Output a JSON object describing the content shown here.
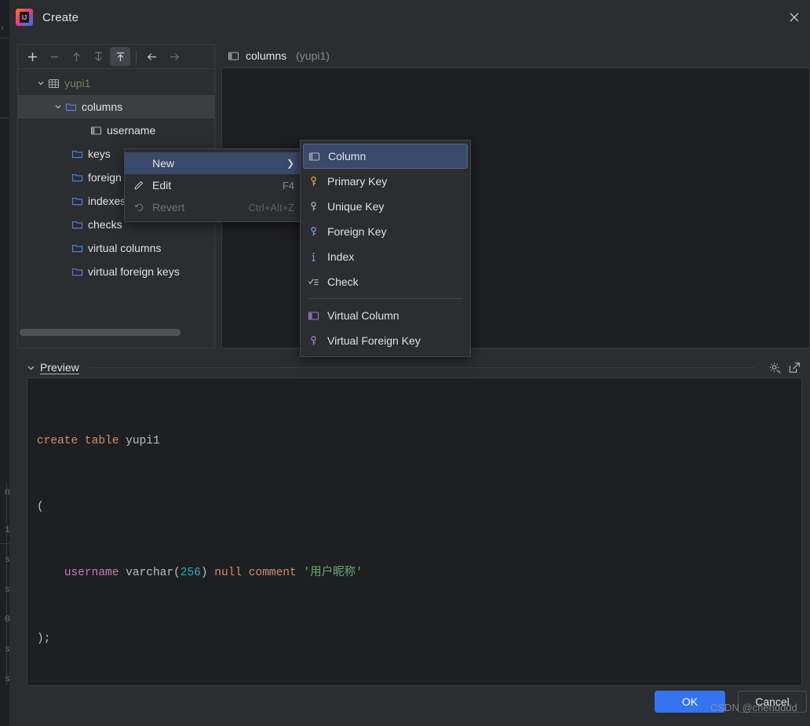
{
  "window": {
    "title": "Create",
    "logo_icon": "intellij-idea-logo",
    "close_icon": "close-icon"
  },
  "toolbar": {
    "buttons": [
      {
        "name": "add-button",
        "icon": "plus-icon",
        "enabled": true,
        "active": false
      },
      {
        "name": "remove-button",
        "icon": "minus-icon",
        "enabled": false,
        "active": false
      },
      {
        "name": "move-up-button",
        "icon": "arrow-up-icon",
        "enabled": false,
        "active": false
      },
      {
        "name": "move-down-button",
        "icon": "arrow-down-icon",
        "enabled": false,
        "active": false
      },
      {
        "name": "move-to-top-button",
        "icon": "arrow-to-top-icon",
        "enabled": true,
        "active": true
      },
      {
        "name": "back-button",
        "icon": "arrow-left-icon",
        "enabled": true,
        "active": false
      },
      {
        "name": "forward-button",
        "icon": "arrow-right-icon",
        "enabled": false,
        "active": false
      }
    ]
  },
  "tree": {
    "nodes": [
      {
        "label": "yupi1",
        "icon": "table-icon",
        "indent": 0,
        "expanded": true,
        "selected": false,
        "color": "green"
      },
      {
        "label": "columns",
        "icon": "folder-icon",
        "indent": 1,
        "expanded": true,
        "selected": true,
        "color": "default"
      },
      {
        "label": "username",
        "icon": "column-icon",
        "indent": 2,
        "expanded": null,
        "selected": false,
        "color": "default"
      },
      {
        "label": "keys",
        "icon": "folder-icon",
        "indent": 1,
        "expanded": null,
        "selected": false,
        "color": "default"
      },
      {
        "label": "foreign keys",
        "icon": "folder-icon",
        "indent": 1,
        "expanded": null,
        "selected": false,
        "color": "default"
      },
      {
        "label": "indexes",
        "icon": "folder-icon",
        "indent": 1,
        "expanded": null,
        "selected": false,
        "color": "default"
      },
      {
        "label": "checks",
        "icon": "folder-icon",
        "indent": 1,
        "expanded": null,
        "selected": false,
        "color": "default"
      },
      {
        "label": "virtual columns",
        "icon": "folder-icon",
        "indent": 1,
        "expanded": null,
        "selected": false,
        "color": "default"
      },
      {
        "label": "virtual foreign keys",
        "icon": "folder-icon",
        "indent": 1,
        "expanded": null,
        "selected": false,
        "color": "default"
      }
    ]
  },
  "detail": {
    "icon": "column-icon",
    "name": "columns",
    "owner": "(yupi1)"
  },
  "context_menu": {
    "items": [
      {
        "label": "New",
        "icon": "none",
        "accel": "",
        "highlighted": true,
        "disabled": false,
        "submenu": true
      },
      {
        "label": "Edit",
        "icon": "pencil-icon",
        "accel": "F4",
        "highlighted": false,
        "disabled": false,
        "submenu": false
      },
      {
        "label": "Revert",
        "icon": "revert-icon",
        "accel": "Ctrl+Alt+Z",
        "highlighted": false,
        "disabled": true,
        "submenu": false
      }
    ]
  },
  "submenu": {
    "items": [
      {
        "label": "Column",
        "icon": "column-icon",
        "highlighted": true,
        "divider_after": false
      },
      {
        "label": "Primary Key",
        "icon": "primary-key-icon",
        "highlighted": false,
        "divider_after": false
      },
      {
        "label": "Unique Key",
        "icon": "unique-key-icon",
        "highlighted": false,
        "divider_after": false
      },
      {
        "label": "Foreign Key",
        "icon": "foreign-key-icon",
        "highlighted": false,
        "divider_after": false
      },
      {
        "label": "Index",
        "icon": "index-icon",
        "highlighted": false,
        "divider_after": false
      },
      {
        "label": "Check",
        "icon": "check-constraint-icon",
        "highlighted": false,
        "divider_after": true
      },
      {
        "label": "Virtual Column",
        "icon": "virtual-column-icon",
        "highlighted": false,
        "divider_after": false
      },
      {
        "label": "Virtual Foreign Key",
        "icon": "virtual-foreign-key-icon",
        "highlighted": false,
        "divider_after": false
      }
    ]
  },
  "preview": {
    "title": "Preview",
    "expanded": true,
    "settings_icon": "gear-icon",
    "open_external_icon": "external-link-icon",
    "sql_lines": [
      "create table yupi1",
      "(",
      "    username varchar(256) null comment '用户昵称'",
      ");"
    ],
    "sql_tokens": [
      [
        {
          "t": "create",
          "c": "kw"
        },
        {
          "t": " ",
          "c": "plain"
        },
        {
          "t": "table",
          "c": "kw"
        },
        {
          "t": " yupi1",
          "c": "plain"
        }
      ],
      [
        {
          "t": "(",
          "c": "plain"
        }
      ],
      [
        {
          "t": "    ",
          "c": "plain"
        },
        {
          "t": "username",
          "c": "id"
        },
        {
          "t": " varchar(",
          "c": "plain"
        },
        {
          "t": "256",
          "c": "num"
        },
        {
          "t": ") ",
          "c": "plain"
        },
        {
          "t": "null",
          "c": "kw"
        },
        {
          "t": " ",
          "c": "plain"
        },
        {
          "t": "comment",
          "c": "kw"
        },
        {
          "t": " ",
          "c": "plain"
        },
        {
          "t": "'用户昵称'",
          "c": "str"
        }
      ],
      [
        {
          "t": ");",
          "c": "plain"
        }
      ]
    ]
  },
  "footer": {
    "ok_label": "OK",
    "cancel_label": "Cancel"
  },
  "watermark": {
    "text": "CSDN @chendddd"
  },
  "colors": {
    "dialog_bg": "#2b2d30",
    "editor_bg": "#1e1f22",
    "border": "#393b40",
    "accent_blue": "#3574f0",
    "menu_highlight": "#3b4a6b",
    "selection_bg": "#3c3f41",
    "text": "#dfe1e5",
    "text_dim": "#868a91",
    "table_green": "#6a8759",
    "folder_blue": "#4c7ee0",
    "key_gold": "#d9a343",
    "key_gray": "#a9adb4",
    "key_blue": "#6e9de0",
    "virtual_purple": "#a875d6"
  }
}
